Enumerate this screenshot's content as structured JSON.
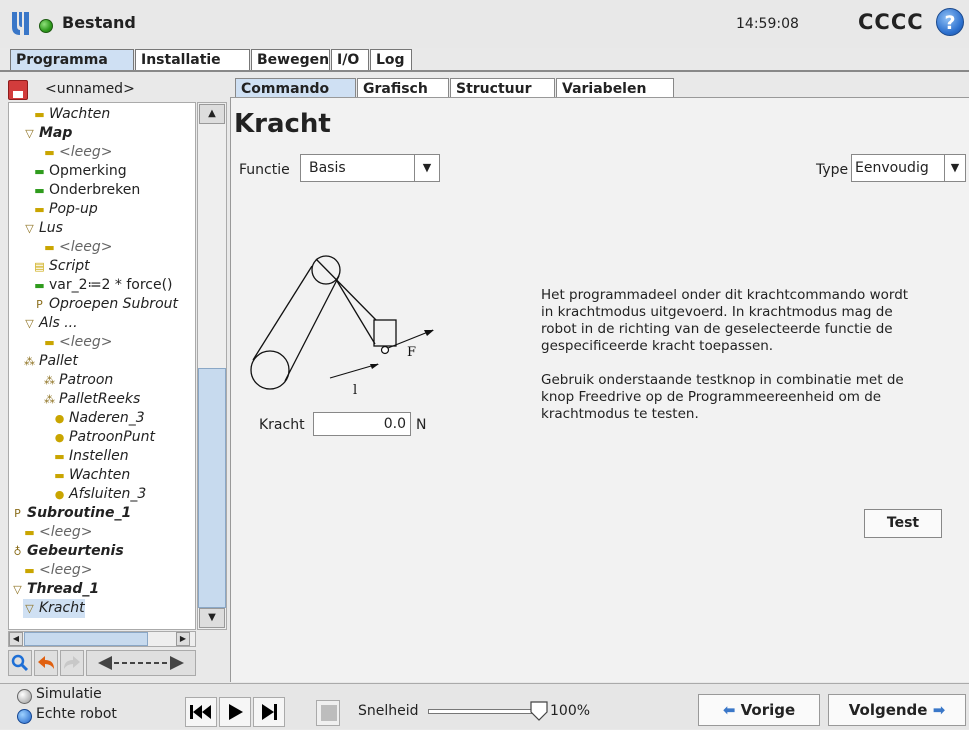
{
  "header": {
    "app_title": "Bestand",
    "clock": "14:59:08",
    "robot_name": "CCCC",
    "help_glyph": "?"
  },
  "main_tabs": [
    {
      "label": "Programma",
      "active": true
    },
    {
      "label": "Installatie",
      "active": false
    },
    {
      "label": "Bewegen",
      "active": false
    },
    {
      "label": "I/O",
      "active": false
    },
    {
      "label": "Log",
      "active": false
    }
  ],
  "program": {
    "name": "<unnamed>"
  },
  "tree": [
    {
      "label": "Wachten",
      "icon": "wait-icon",
      "style": "it"
    },
    {
      "label": "Map",
      "icon": "folder-expand-icon",
      "style": "bi"
    },
    {
      "label": "<leeg>",
      "icon": "empty-icon",
      "style": "grey"
    },
    {
      "label": "Opmerking",
      "icon": "comment-icon",
      "style": ""
    },
    {
      "label": "Onderbreken",
      "icon": "halt-icon",
      "style": ""
    },
    {
      "label": "Pop-up",
      "icon": "popup-icon",
      "style": "it"
    },
    {
      "label": "Lus",
      "icon": "loop-icon",
      "style": "it"
    },
    {
      "label": "<leeg>",
      "icon": "empty-icon",
      "style": "grey"
    },
    {
      "label": "Script",
      "icon": "script-icon",
      "style": "it"
    },
    {
      "label": "var_2≔2 * force()",
      "icon": "assignment-icon",
      "style": ""
    },
    {
      "label": "Oproepen Subrout",
      "icon": "call-icon",
      "style": "it"
    },
    {
      "label": "Als ...",
      "icon": "if-icon",
      "style": "it"
    },
    {
      "label": "<leeg>",
      "icon": "empty-icon",
      "style": "grey"
    },
    {
      "label": "Pallet",
      "icon": "pallet-icon",
      "style": "it"
    },
    {
      "label": "Patroon",
      "icon": "pattern-icon",
      "style": "it"
    },
    {
      "label": "PalletReeks",
      "icon": "pallet-sequence-icon",
      "style": "it"
    },
    {
      "label": "Naderen_3",
      "icon": "waypoint-icon",
      "style": "it"
    },
    {
      "label": "PatroonPunt",
      "icon": "waypoint-icon",
      "style": "it"
    },
    {
      "label": "Instellen",
      "icon": "set-icon",
      "style": "it"
    },
    {
      "label": "Wachten",
      "icon": "wait-icon",
      "style": "it"
    },
    {
      "label": "Afsluiten_3",
      "icon": "waypoint-icon",
      "style": "it"
    },
    {
      "label": "Subroutine_1",
      "icon": "subroutine-icon",
      "style": "bi"
    },
    {
      "label": "<leeg>",
      "icon": "empty-icon",
      "style": "grey"
    },
    {
      "label": "Gebeurtenis",
      "icon": "event-icon",
      "style": "bi"
    },
    {
      "label": "<leeg>",
      "icon": "empty-icon",
      "style": "grey"
    },
    {
      "label": "Thread_1",
      "icon": "thread-icon",
      "style": "bi"
    },
    {
      "label": "Kracht",
      "icon": "force-icon",
      "style": "it"
    }
  ],
  "sub_tabs": [
    {
      "label": "Commando",
      "active": true
    },
    {
      "label": "Grafisch",
      "active": false
    },
    {
      "label": "Structuur",
      "active": false
    },
    {
      "label": "Variabelen",
      "active": false
    }
  ],
  "command": {
    "title": "Kracht",
    "function_label": "Functie",
    "function_value": "Basis",
    "type_label": "Type",
    "type_value": "Eenvoudig",
    "diagram_force_label": "F",
    "diagram_l_label": "l",
    "force_label": "Kracht",
    "force_value": "0.0",
    "force_unit": "N",
    "description_1": "Het programmadeel onder dit krachtcommando wordt in krachtmodus uitgevoerd. In krachtmodus mag de robot in de richting van de geselecteerde functie de gespecificeerde kracht toepassen.",
    "description_2": "Gebruik onderstaande testknop in combinatie met de knop Freedrive op de Programmeereenheid om de krachtmodus te testen.",
    "test_button": "Test"
  },
  "footer": {
    "simulation_label": "Simulatie",
    "real_robot_label": "Echte robot",
    "speed_label": "Snelheid",
    "speed_value": "100%",
    "speed_fraction": 1.0,
    "prev_button": "Vorige",
    "next_button": "Volgende"
  },
  "colors": {
    "active_tab": "#cfe0f3",
    "status_green": "#2f9b1d",
    "help_blue": "#2b6fce"
  }
}
